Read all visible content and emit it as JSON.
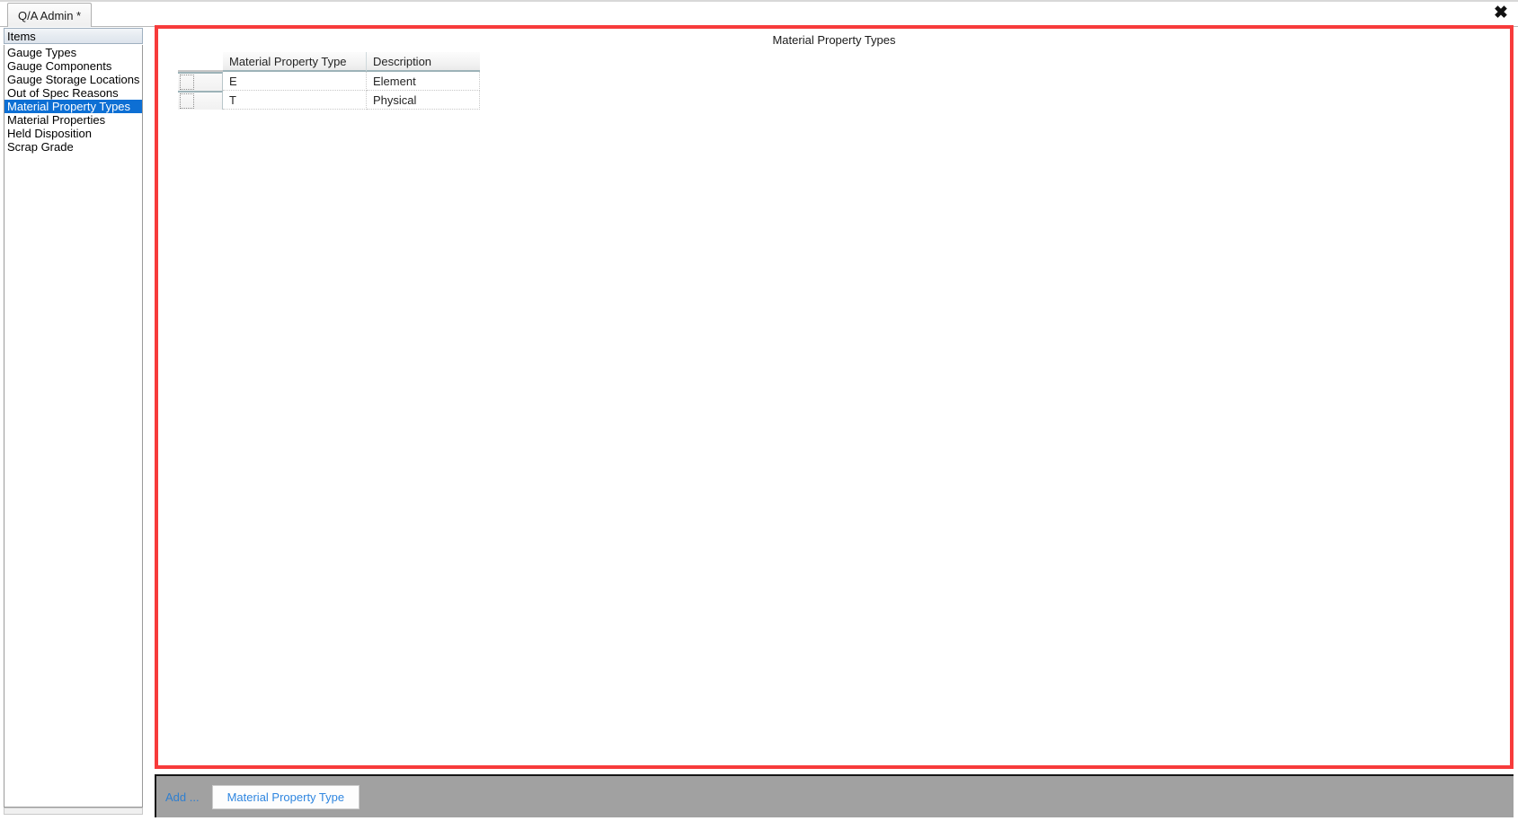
{
  "window": {
    "close_icon": "close-icon",
    "close_glyph": "✖"
  },
  "tabs": [
    {
      "label": "Q/A Admin *",
      "active": true
    }
  ],
  "sidebar": {
    "header": "Items",
    "items": [
      {
        "label": "Gauge Types",
        "selected": false
      },
      {
        "label": "Gauge Components",
        "selected": false
      },
      {
        "label": "Gauge Storage Locations",
        "selected": false
      },
      {
        "label": "Out of Spec Reasons",
        "selected": false
      },
      {
        "label": "Material Property Types",
        "selected": true
      },
      {
        "label": "Material Properties",
        "selected": false
      },
      {
        "label": "Held Disposition",
        "selected": false
      },
      {
        "label": "Scrap Grade",
        "selected": false
      }
    ]
  },
  "main": {
    "title": "Material Property Types",
    "grid": {
      "columns": [
        "Material Property Type",
        "Description"
      ],
      "rows": [
        {
          "type": "E",
          "description": "Element"
        },
        {
          "type": "T",
          "description": "Physical"
        }
      ]
    }
  },
  "footer": {
    "add_label": "Add ...",
    "add_button_label": "Material Property Type"
  },
  "colors": {
    "accent_border": "#f73b3b",
    "selection": "#0d6fd4",
    "link": "#2f86e0",
    "footer_bg": "#a1a1a1"
  }
}
